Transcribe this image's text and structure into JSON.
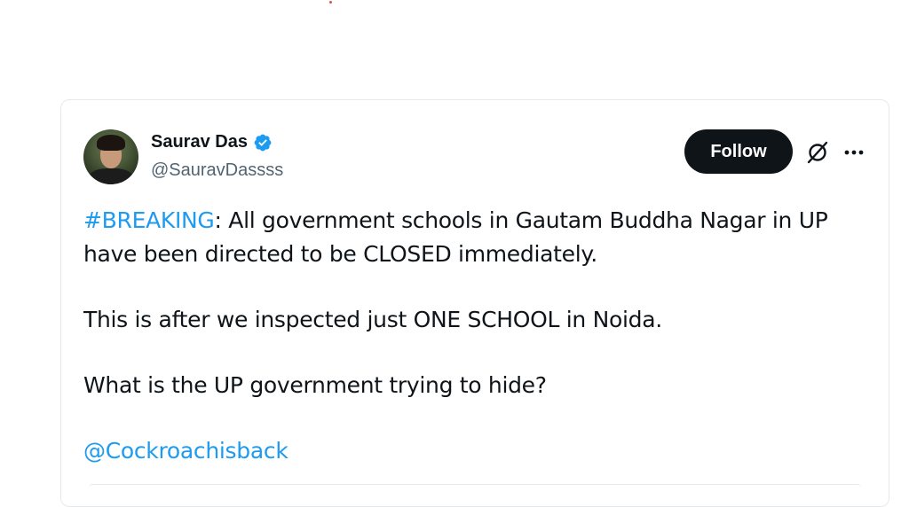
{
  "user": {
    "display_name": "Saurav Das",
    "handle": "@SauravDassss",
    "verified": true
  },
  "actions": {
    "follow_label": "Follow",
    "grok_icon": "grok-icon",
    "more_icon": "more-options-icon"
  },
  "tweet": {
    "line1_hashtag": "#BREAKING",
    "line1_rest": ": All government schools in Gautam Buddha Nagar in UP",
    "line2": "have been directed to be CLOSED immediately.",
    "para2": "This is after we inspected just ONE SCHOOL in Noida.",
    "para3": "What is the UP government trying to hide?",
    "mention": "@Cockroachisback"
  },
  "colors": {
    "link": "#1d9bf0",
    "text": "#0f1419",
    "secondary": "#536471",
    "follow_bg": "#0f1419"
  }
}
